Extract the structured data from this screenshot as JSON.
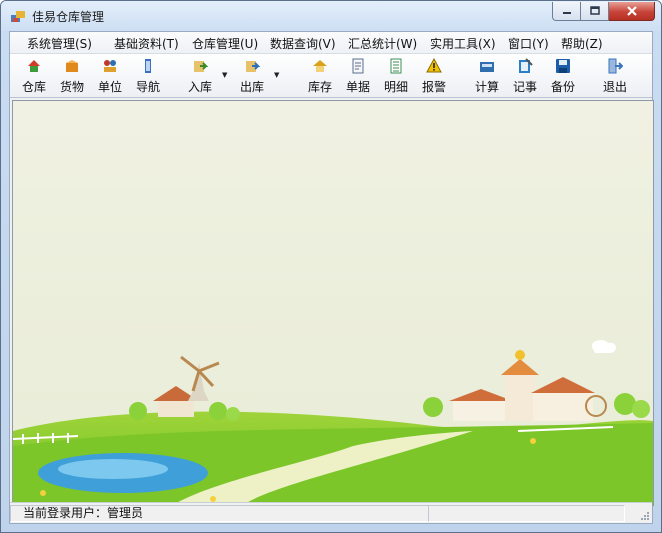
{
  "window": {
    "title": "佳易仓库管理"
  },
  "menu": [
    "系统管理(S)",
    "基础资料(T)",
    "仓库管理(U)",
    "数据查询(V)",
    "汇总统计(W)",
    "实用工具(X)",
    "窗口(Y)",
    "帮助(Z)"
  ],
  "toolbar": [
    {
      "label": "仓库",
      "icon": "warehouse-icon",
      "color": "#d23b2a"
    },
    {
      "label": "货物",
      "icon": "goods-icon",
      "color": "#e08a1e"
    },
    {
      "label": "单位",
      "icon": "units-icon",
      "color": "#c0392b"
    },
    {
      "label": "导航",
      "icon": "navigation-icon",
      "color": "#3a6fc4"
    },
    {
      "label": "入库",
      "icon": "stock-in-icon",
      "color": "#6a9d2b"
    },
    {
      "label": "出库",
      "icon": "stock-out-icon",
      "color": "#4b8dc9"
    },
    {
      "label": "库存",
      "icon": "inventory-icon",
      "color": "#d9a21b"
    },
    {
      "label": "单据",
      "icon": "documents-icon",
      "color": "#5a6f8f"
    },
    {
      "label": "明细",
      "icon": "details-icon",
      "color": "#3c8f55"
    },
    {
      "label": "报警",
      "icon": "alarm-icon",
      "color": "#e6b800"
    },
    {
      "label": "计算",
      "icon": "calculator-icon",
      "color": "#2f6fb0"
    },
    {
      "label": "记事",
      "icon": "notepad-icon",
      "color": "#2b7fc8"
    },
    {
      "label": "备份",
      "icon": "backup-icon",
      "color": "#1d5ea8"
    },
    {
      "label": "退出",
      "icon": "exit-icon",
      "color": "#3a74c0"
    }
  ],
  "status": {
    "user_text": "当前登录用户：管理员"
  }
}
